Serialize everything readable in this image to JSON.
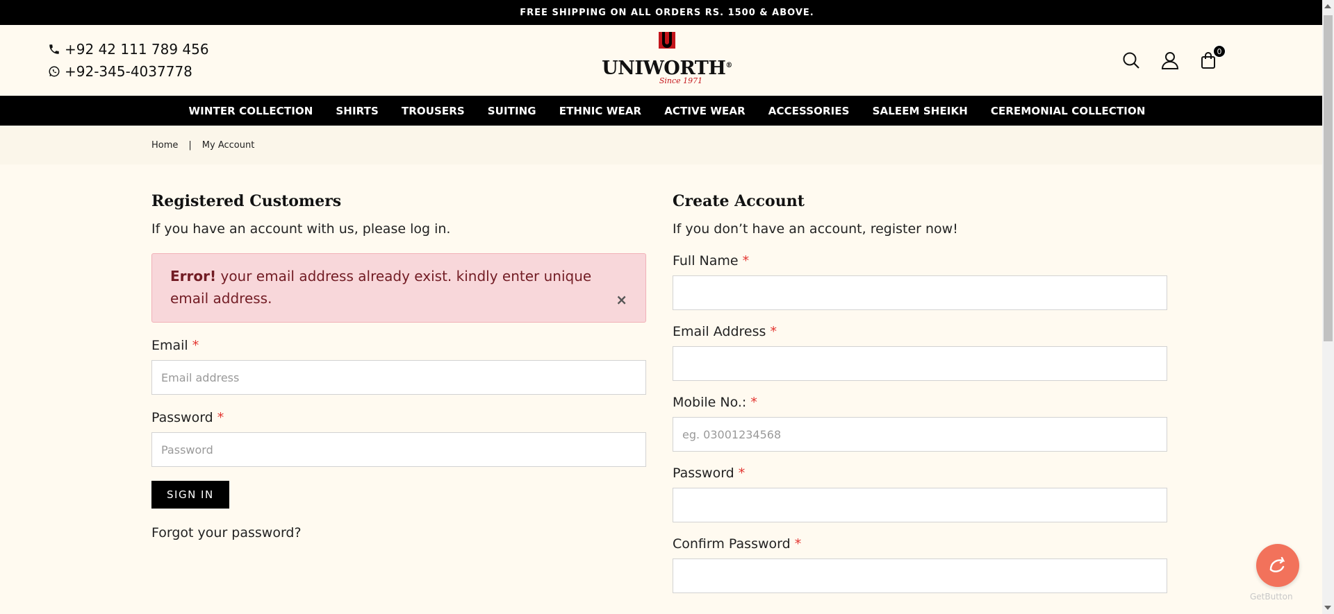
{
  "topbar": {
    "text": "FREE SHIPPING ON ALL ORDERS RS. 1500 & ABOVE."
  },
  "header": {
    "phone": "+92 42 111 789 456",
    "whatsapp": "+92-345-4037778",
    "logo_text": "UNIWORTH",
    "logo_reg": "®",
    "logo_sub": "Since 1971",
    "cart_count": "0"
  },
  "nav": {
    "items": [
      "WINTER COLLECTION",
      "SHIRTS",
      "TROUSERS",
      "SUITING",
      "ETHNIC WEAR",
      "ACTIVE WEAR",
      "ACCESSORIES",
      "SALEEM SHEIKH",
      "CEREMONIAL COLLECTION"
    ]
  },
  "breadcrumb": {
    "home": "Home",
    "separator": "|",
    "current": "My Account"
  },
  "login": {
    "title": "Registered Customers",
    "intro": "If you have an account with us, please log in.",
    "error_strong": "Error!",
    "error_text": " your email address already exist. kindly enter unique email address.",
    "error_close": "×",
    "email_label": "Email",
    "email_placeholder": "Email address",
    "password_label": "Password",
    "password_placeholder": "Password",
    "required": "*",
    "signin_label": "SIGN IN",
    "forgot_label": "Forgot your password?"
  },
  "register": {
    "title": "Create Account",
    "intro": "If you don’t have an account, register now!",
    "fullname_label": "Full Name",
    "email_label": "Email Address",
    "mobile_label": "Mobile No.:",
    "mobile_placeholder": "eg. 03001234568",
    "password_label": "Password",
    "confirm_label": "Confirm Password",
    "required": "*"
  },
  "widget": {
    "brand": "GetButton"
  },
  "colors": {
    "background": "#fffaf0",
    "bar": "#000000",
    "alert_bg": "#f8d7da",
    "alert_text": "#721c24",
    "required": "#e3342f",
    "logo_red": "#c4161c",
    "chat": "#f2725b"
  }
}
